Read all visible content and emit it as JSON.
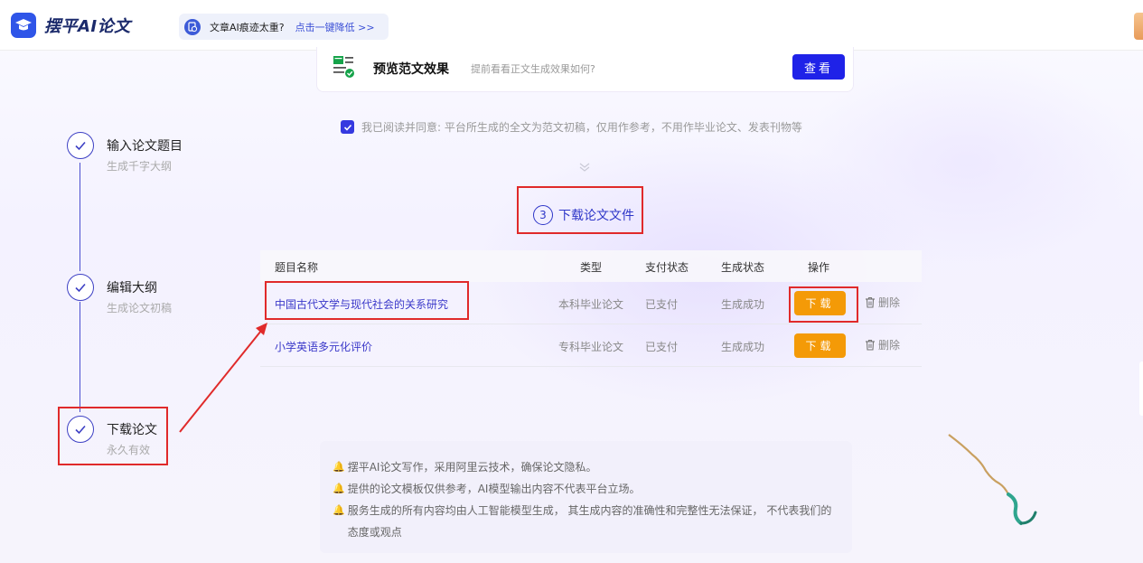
{
  "topbar": {
    "logo_text": "摆平AI论文",
    "notice_text": "文章AI痕迹太重?",
    "notice_link": "点击一键降低 >>"
  },
  "preview": {
    "title": "预览范文效果",
    "description": "提前看看正文生成效果如何?",
    "button": "查看"
  },
  "agreement": {
    "checked": true,
    "text": "我已阅读并同意: 平台所生成的全文为范文初稿，仅用作参考，不用作毕业论文、发表刊物等"
  },
  "section": {
    "step_number": "3",
    "title": "下载论文文件"
  },
  "steps": [
    {
      "title": "输入论文题目",
      "subtitle": "生成千字大纲"
    },
    {
      "title": "编辑大纲",
      "subtitle": "生成论文初稿"
    },
    {
      "title": "下载论文",
      "subtitle": "永久有效"
    }
  ],
  "table": {
    "headers": {
      "title": "题目名称",
      "type": "类型",
      "pay": "支付状态",
      "gen": "生成状态",
      "op": "操作"
    },
    "rows": [
      {
        "title": "中国古代文学与现代社会的关系研究",
        "type": "本科毕业论文",
        "pay": "已支付",
        "gen": "生成成功",
        "download": "下载",
        "delete": "删除"
      },
      {
        "title": "小学英语多元化评价",
        "type": "专科毕业论文",
        "pay": "已支付",
        "gen": "生成成功",
        "download": "下载",
        "delete": "删除"
      }
    ]
  },
  "info": {
    "lines": [
      "摆平AI论文写作，采用阿里云技术，确保论文隐私。",
      "提供的论文模板仅供参考，AI模型输出内容不代表平台立场。",
      "服务生成的所有内容均由人工智能模型生成， 其生成内容的准确性和完整性无法保证， 不代表我们的态度或观点"
    ]
  },
  "colors": {
    "accent": "#2e36c8",
    "primary_button": "#1f22e8",
    "download_button": "#f49a07",
    "highlight_border": "#e02a2a"
  }
}
